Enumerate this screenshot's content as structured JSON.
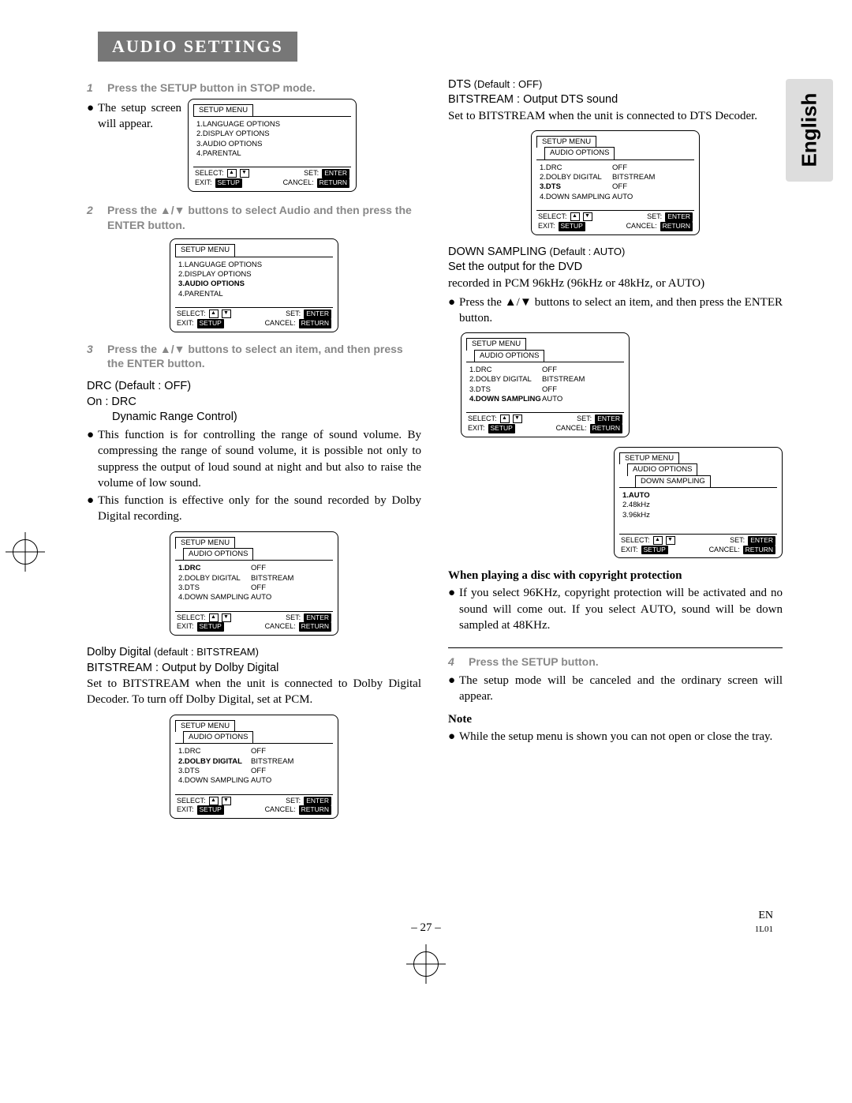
{
  "header": {
    "title": "AUDIO SETTINGS"
  },
  "side_tab": "English",
  "footer": {
    "page": "– 27 –",
    "en": "EN",
    "code": "1L01"
  },
  "left": {
    "step1": {
      "no": "1",
      "text": "Press the SETUP button in STOP mode."
    },
    "step1_body": "The setup screen will appear.",
    "step2": {
      "no": "2",
      "text": "Press the ▲/▼ buttons to select Audio and then press the ENTER button."
    },
    "step3": {
      "no": "3",
      "text": "Press the ▲/▼ buttons to select an item, and then press the ENTER button."
    },
    "drc_title": "DRC (Default : OFF)",
    "drc_on": "On : DRC",
    "drc_sub": "Dynamic Range Control)",
    "drc_p1": "This function is for controlling the range of sound volume. By compressing the range of sound volume, it is possible not only to suppress the output of loud sound at night and but also to raise the volume of low sound.",
    "drc_p2": "This function is effective only for the sound recorded by Dolby Digital recording.",
    "dolby_title_strong": "Dolby Digital",
    "dolby_title_rest": " (default : BITSTREAM)",
    "dolby_l1": "BITSTREAM : Output by Dolby Digital",
    "dolby_l2": "Set to BITSTREAM when the unit is connected to Dolby Digital Decoder. To turn off Dolby Digital, set at PCM."
  },
  "right": {
    "dts_title_strong": "DTS",
    "dts_title_rest": " (Default : OFF)",
    "dts_l1": "BITSTREAM : Output DTS sound",
    "dts_l2": "Set to BITSTREAM when the unit is connected to DTS Decoder.",
    "down_title_strong": "DOWN SAMPLING",
    "down_title_rest": " (Default : AUTO)",
    "down_l1": "Set the output for the DVD",
    "down_l2": "recorded in PCM 96kHz (96kHz or 48kHz, or AUTO)",
    "down_p1": "Press the ▲/▼ buttons to select an item, and then press the ENTER button.",
    "copyright_heading": "When playing a disc with copyright protection",
    "copyright_p": "If you select 96KHz, copyright protection will be activated and no sound will come out. If you select AUTO, sound will be down sampled at 48KHz.",
    "step4": {
      "no": "4",
      "text": "Press the SETUP button."
    },
    "step4_body": "The setup mode will be canceled and the ordinary screen will appear.",
    "note_heading": "Note",
    "note_p": "While the setup menu is shown you can not open or close the tray."
  },
  "osd_labels": {
    "setup_menu": "SETUP MENU",
    "audio_options": "AUDIO OPTIONS",
    "down_sampling": "DOWN SAMPLING",
    "main_items": [
      "1.LANGUAGE OPTIONS",
      "2.DISPLAY OPTIONS",
      "3.AUDIO OPTIONS",
      "4.PARENTAL"
    ],
    "audio_items": [
      {
        "l": "1.DRC",
        "r": "OFF"
      },
      {
        "l": "2.DOLBY DIGITAL",
        "r": "BITSTREAM"
      },
      {
        "l": "3.DTS",
        "r": "OFF"
      },
      {
        "l": "4.DOWN SAMPLING",
        "r": "AUTO"
      }
    ],
    "down_items": [
      "1.AUTO",
      "2.48kHz",
      "3.96kHz"
    ],
    "foot": {
      "select": "SELECT:",
      "set": "SET:",
      "enter": "ENTER",
      "exit": "EXIT:",
      "setup": "SETUP",
      "cancel": "CANCEL:",
      "return": "RETURN"
    }
  }
}
